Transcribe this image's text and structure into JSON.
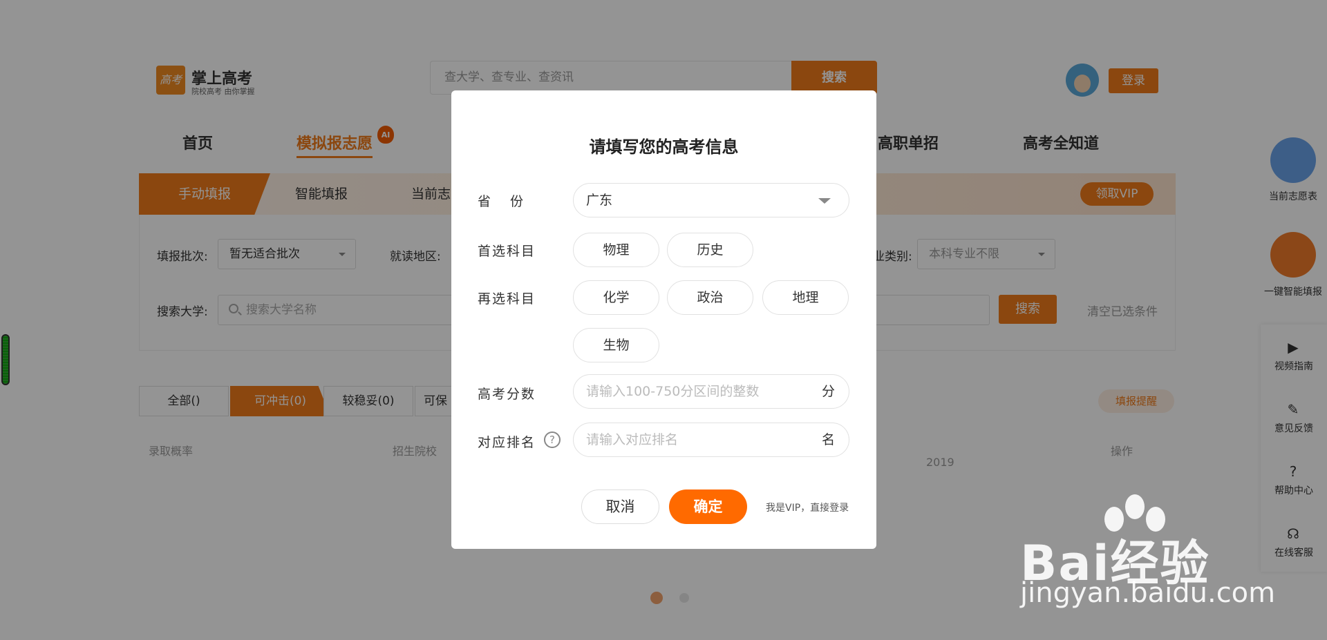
{
  "header": {
    "logo_mark": "高考",
    "logo_title": "掌上高考",
    "logo_sub": "院校高考 由你掌握",
    "search_placeholder": "查大学、查专业、查资讯",
    "search_button": "搜索",
    "login_button": "登录"
  },
  "nav": {
    "items": [
      "首页",
      "模拟报志愿",
      "高职单招",
      "高考全知道"
    ],
    "ai_badge": "AI"
  },
  "tabs": {
    "items": [
      "手动填报",
      "智能填报",
      "当前志"
    ],
    "vip_button": "领取VIP"
  },
  "filters": {
    "batch_label": "填报批次:",
    "batch_value": "暂无适合批次",
    "region_label": "就读地区:",
    "category_label": "业类别:",
    "category_value": "本科专业不限",
    "search_label": "搜索大学:",
    "search_placeholder": "搜索大学名称",
    "search_button": "搜索",
    "clear_link": "清空已选条件"
  },
  "result_tabs": {
    "items": [
      "全部()",
      "可冲击(0)",
      "较稳妥(0)",
      "可保"
    ],
    "remind_button": "填报提醒"
  },
  "table_headers": [
    "录取概率",
    "招生院校",
    "2019",
    "操作"
  ],
  "side": {
    "current_list": "当前志愿表",
    "smart_fill": "一键智能填报",
    "tools": [
      {
        "icon": "▶",
        "label": "视频指南"
      },
      {
        "icon": "✎",
        "label": "意见反馈"
      },
      {
        "icon": "?",
        "label": "帮助中心"
      },
      {
        "icon": "☊",
        "label": "在线客服"
      }
    ]
  },
  "modal": {
    "title": "请填写您的高考信息",
    "province_label": "省份",
    "province_value": "广东",
    "first_subject_label": "首选科目",
    "first_subjects": [
      "物理",
      "历史"
    ],
    "second_subject_label": "再选科目",
    "second_subjects": [
      "化学",
      "政治",
      "地理",
      "生物"
    ],
    "score_label": "高考分数",
    "score_placeholder": "请输入100-750分区间的整数",
    "score_unit": "分",
    "rank_label": "对应排名",
    "rank_placeholder": "请输入对应排名",
    "rank_unit": "名",
    "cancel_button": "取消",
    "confirm_button": "确定",
    "vip_link": "我是VIP，直接登录"
  },
  "watermark": {
    "text": "Bai经验",
    "url": "jingyan.baidu.com"
  }
}
